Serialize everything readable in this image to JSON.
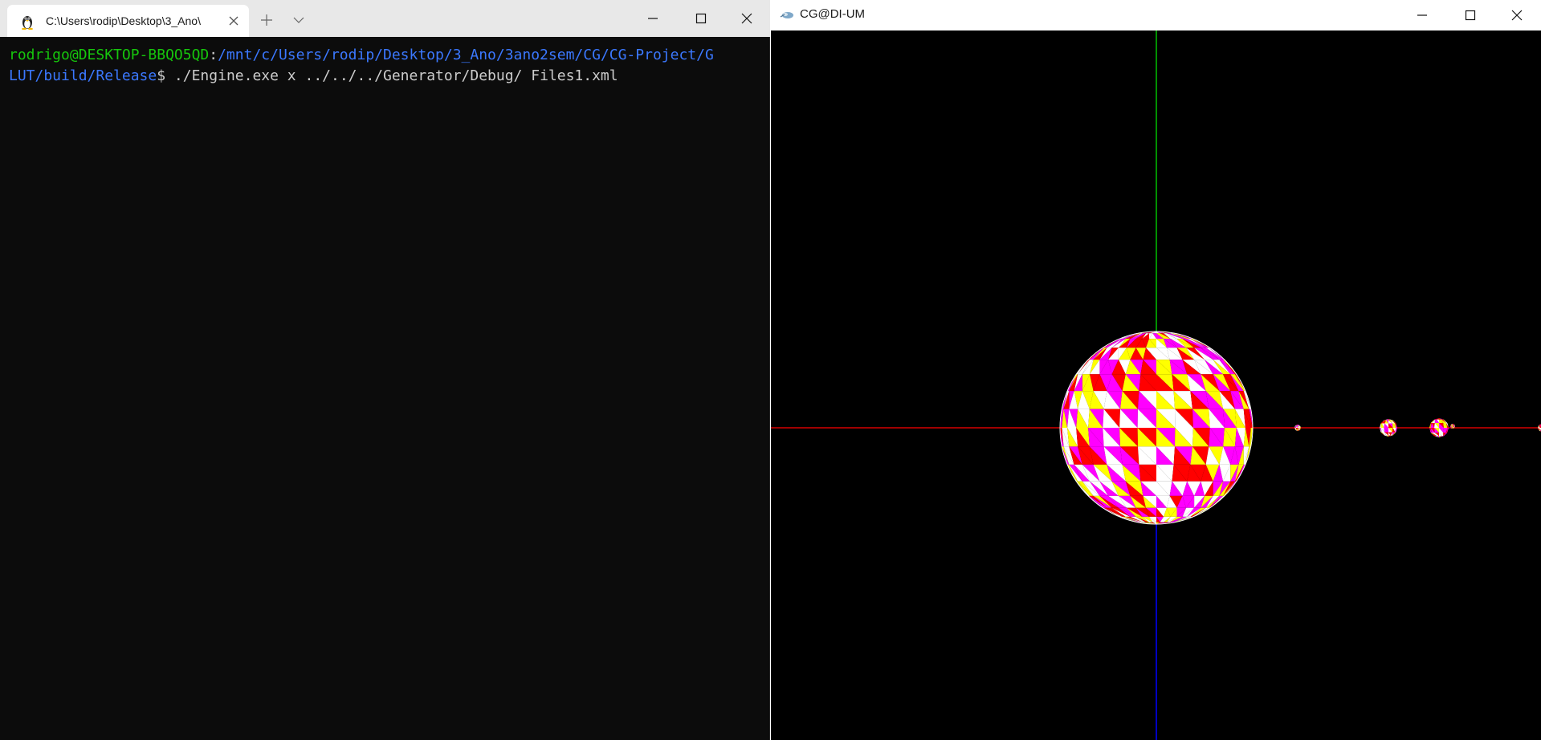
{
  "terminal": {
    "tab_title": "C:\\Users\\rodip\\Desktop\\3_Ano\\",
    "prompt_user": "rodrigo@DESKTOP-BBQO5QD",
    "prompt_sep": ":",
    "prompt_path_line1": "/mnt/c/Users/rodip/Desktop/3_Ano/3ano2sem/CG/CG-Project/G",
    "prompt_path_line2": "LUT/build/Release",
    "prompt_dollar": "$ ",
    "command": "./Engine.exe x ../../../Generator/Debug/ Files1.xml",
    "icons": {
      "tab": "tux-linux-icon",
      "close_tab": "close-icon",
      "new_tab": "plus-icon",
      "dropdown": "chevron-down-icon"
    }
  },
  "glut": {
    "title": "CG@DI-UM",
    "icon": "glut-app-icon",
    "scene": {
      "axes_colors": {
        "x": "#ff0000",
        "y": "#00c000",
        "z": "#0000ff"
      },
      "palette": [
        "#ffffff",
        "#ff00ff",
        "#ffff00",
        "#ff0000"
      ],
      "bodies": [
        "central-sphere",
        "planet-1",
        "planet-2",
        "planet-3",
        "moon-1",
        "planet-4"
      ]
    }
  },
  "window_controls": [
    "minimize-icon",
    "maximize-icon",
    "close-icon"
  ],
  "colors": {
    "terminal_bg": "#0c0c0c",
    "prompt_user": "#16c60c",
    "prompt_path": "#3b78ff",
    "text": "#cccccc"
  }
}
